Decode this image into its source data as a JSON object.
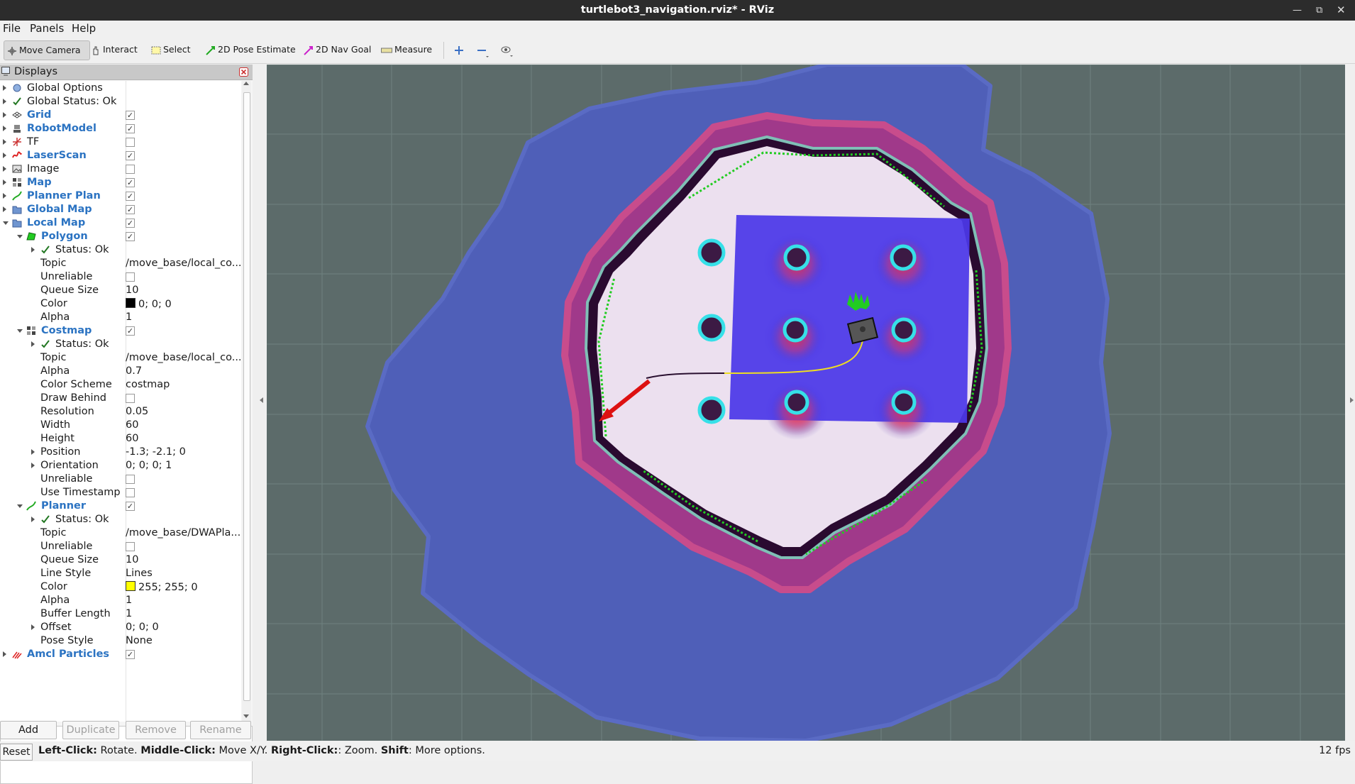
{
  "window": {
    "title": "turtlebot3_navigation.rviz* - RViz"
  },
  "menu": [
    {
      "label": "File"
    },
    {
      "label": "Panels"
    },
    {
      "label": "Help"
    }
  ],
  "toolbar": {
    "tools": [
      {
        "label": "Move Camera",
        "icon": "move-camera-icon",
        "active": true
      },
      {
        "label": "Interact",
        "icon": "hand-icon"
      },
      {
        "label": "Select",
        "icon": "select-box-icon"
      },
      {
        "label": "2D Pose Estimate",
        "icon": "green-arrow-icon"
      },
      {
        "label": "2D Nav Goal",
        "icon": "magenta-arrow-icon"
      },
      {
        "label": "Measure",
        "icon": "ruler-icon"
      }
    ],
    "extra_icons": [
      "plus-icon",
      "minus-icon",
      "eye-icon"
    ]
  },
  "displays": {
    "title": "Displays",
    "rows": [
      {
        "label": "Global Options",
        "depth": 0,
        "expander": "r",
        "icon": "gear-icon"
      },
      {
        "label": "Global Status: Ok",
        "depth": 0,
        "expander": "r",
        "icon": "check-icon"
      },
      {
        "label": "Grid",
        "depth": 0,
        "expander": "r",
        "icon": "grid-icon",
        "checked": true,
        "blue": true
      },
      {
        "label": "RobotModel",
        "depth": 0,
        "expander": "r",
        "icon": "robot-icon",
        "checked": true,
        "blue": true
      },
      {
        "label": "TF",
        "depth": 0,
        "expander": "r",
        "icon": "tf-icon",
        "checked": false
      },
      {
        "label": "LaserScan",
        "depth": 0,
        "expander": "r",
        "icon": "laser-icon",
        "checked": true,
        "blue": true
      },
      {
        "label": "Image",
        "depth": 0,
        "expander": "r",
        "icon": "image-icon",
        "checked": false
      },
      {
        "label": "Map",
        "depth": 0,
        "expander": "r",
        "icon": "map-icon",
        "checked": true,
        "blue": true
      },
      {
        "label": "Planner Plan",
        "depth": 0,
        "expander": "r",
        "icon": "path-icon",
        "checked": true,
        "blue": true
      },
      {
        "label": "Global Map",
        "depth": 0,
        "expander": "r",
        "icon": "folder-icon",
        "checked": true,
        "blue": true
      },
      {
        "label": "Local Map",
        "depth": 0,
        "expander": "d",
        "icon": "folder-icon",
        "checked": true,
        "blue": true
      },
      {
        "label": "Polygon",
        "depth": 1,
        "expander": "d",
        "icon": "polygon-icon",
        "checked": true,
        "blue": true
      },
      {
        "label": "Status: Ok",
        "depth": 2,
        "expander": "r",
        "icon": "check-icon"
      },
      {
        "label": "Topic",
        "depth": 2,
        "value": "/move_base/local_co..."
      },
      {
        "label": "Unreliable",
        "depth": 2,
        "checked": false
      },
      {
        "label": "Queue Size",
        "depth": 2,
        "value": "10"
      },
      {
        "label": "Color",
        "depth": 2,
        "value": "0; 0; 0",
        "swatch": "#000000"
      },
      {
        "label": "Alpha",
        "depth": 2,
        "value": "1"
      },
      {
        "label": "Costmap",
        "depth": 1,
        "expander": "d",
        "icon": "map-icon",
        "checked": true,
        "blue": true
      },
      {
        "label": "Status: Ok",
        "depth": 2,
        "expander": "r",
        "icon": "check-icon"
      },
      {
        "label": "Topic",
        "depth": 2,
        "value": "/move_base/local_co..."
      },
      {
        "label": "Alpha",
        "depth": 2,
        "value": "0.7"
      },
      {
        "label": "Color Scheme",
        "depth": 2,
        "value": "costmap"
      },
      {
        "label": "Draw Behind",
        "depth": 2,
        "checked": false
      },
      {
        "label": "Resolution",
        "depth": 2,
        "value": "0.05"
      },
      {
        "label": "Width",
        "depth": 2,
        "value": "60"
      },
      {
        "label": "Height",
        "depth": 2,
        "value": "60"
      },
      {
        "label": "Position",
        "depth": 2,
        "expander": "r",
        "value": "-1.3; -2.1; 0"
      },
      {
        "label": "Orientation",
        "depth": 2,
        "expander": "r",
        "value": "0; 0; 0; 1"
      },
      {
        "label": "Unreliable",
        "depth": 2,
        "checked": false
      },
      {
        "label": "Use Timestamp",
        "depth": 2,
        "checked": false
      },
      {
        "label": "Planner",
        "depth": 1,
        "expander": "d",
        "icon": "path-icon",
        "checked": true,
        "blue": true
      },
      {
        "label": "Status: Ok",
        "depth": 2,
        "expander": "r",
        "icon": "check-icon"
      },
      {
        "label": "Topic",
        "depth": 2,
        "value": "/move_base/DWAPla..."
      },
      {
        "label": "Unreliable",
        "depth": 2,
        "checked": false
      },
      {
        "label": "Queue Size",
        "depth": 2,
        "value": "10"
      },
      {
        "label": "Line Style",
        "depth": 2,
        "value": "Lines"
      },
      {
        "label": "Color",
        "depth": 2,
        "value": "255; 255; 0",
        "swatch": "#ffff00"
      },
      {
        "label": "Alpha",
        "depth": 2,
        "value": "1"
      },
      {
        "label": "Buffer Length",
        "depth": 2,
        "value": "1"
      },
      {
        "label": "Offset",
        "depth": 2,
        "expander": "r",
        "value": "0; 0; 0"
      },
      {
        "label": "Pose Style",
        "depth": 2,
        "value": "None"
      },
      {
        "label": "Amcl Particles",
        "depth": 0,
        "expander": "r",
        "icon": "particles-icon",
        "checked": true,
        "blue": true
      }
    ]
  },
  "buttons": {
    "add": "Add",
    "duplicate": "Duplicate",
    "remove": "Remove",
    "rename": "Rename"
  },
  "status": {
    "reset": "Reset",
    "hints": [
      {
        "key": "Left-Click:",
        "text": " Rotate. "
      },
      {
        "key": "Middle-Click:",
        "text": " Move X/Y. "
      },
      {
        "key": "Right-Click:",
        "text": ": Zoom. "
      },
      {
        "key": "Shift",
        "text": ": More options."
      }
    ],
    "fps": "12 fps"
  },
  "colors": {
    "costmap_outer": "#4a5bb4",
    "local_costmap": "#4b38e8",
    "inflation": "#e8d0e4",
    "scan_points": "#22cc22",
    "goal_arrow": "#dd1111"
  }
}
